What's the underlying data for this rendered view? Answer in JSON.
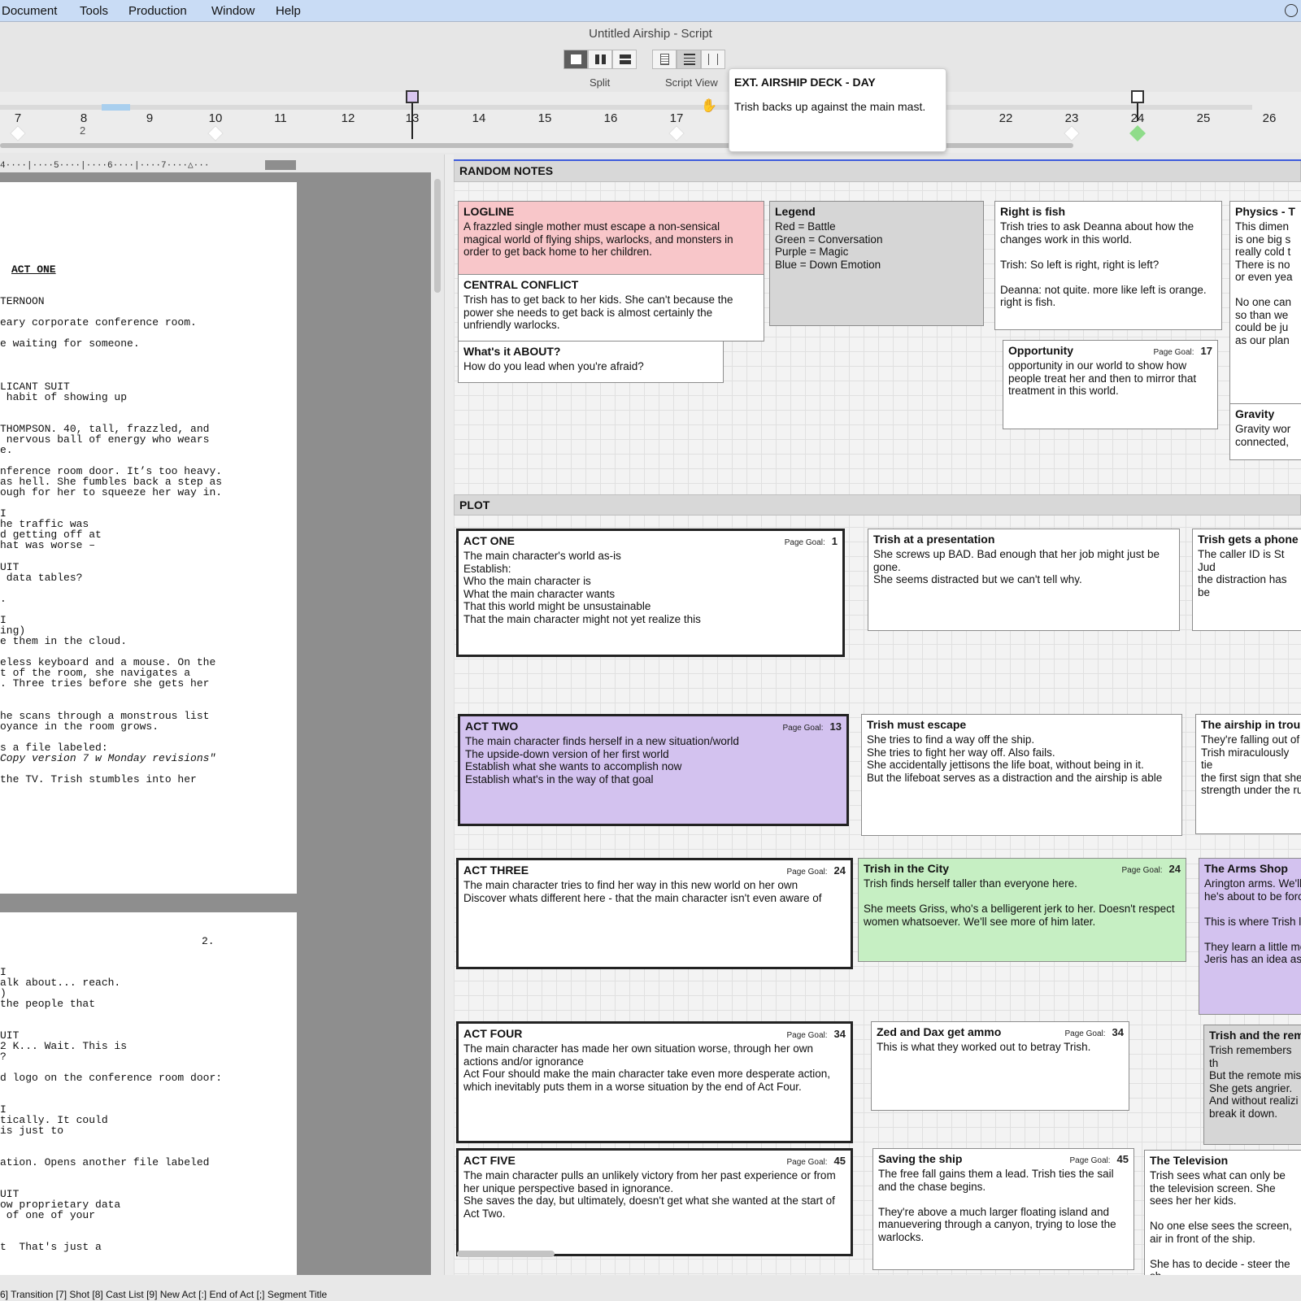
{
  "menu": {
    "items": [
      "Document",
      "Tools",
      "Production",
      "Window",
      "Help"
    ]
  },
  "window": {
    "title": "Untitled Airship - Script"
  },
  "toolbar": {
    "split_label": "Split",
    "script_view_label": "Script View"
  },
  "timeline": {
    "numbers": [
      "7",
      "8",
      "9",
      "10",
      "11",
      "12",
      "13",
      "14",
      "15",
      "16",
      "17",
      "22",
      "23",
      "24",
      "25",
      "26"
    ],
    "sub_label": "2"
  },
  "tooltip": {
    "heading": "EXT. AIRSHIP DECK - DAY",
    "body": "Trish backs up against the main mast."
  },
  "ruler": "4····|····5····|····6····|····7····△···",
  "script": {
    "page1": [
      "ACT ONE",
      "TERNOON",
      "eary corporate conference room.",
      "e waiting for someone.",
      "LICANT SUIT",
      " habit of showing up",
      "THOMPSON. 40, tall, frazzled, and",
      " nervous ball of energy who wears",
      "e.",
      "nference room door. It’s too heavy.",
      "as hell. She fumbles back a step as",
      "ough for her to squeeze her way in.",
      "I",
      "he traffic was",
      "d getting off at",
      "hat was worse –",
      "UIT",
      " data tables?",
      ".",
      "I",
      "ing)",
      "e them in the cloud.",
      "eless keyboard and a mouse. On the",
      "t of the room, she navigates a",
      ". Three tries before she gets her",
      "he scans through a monstrous list",
      "oyance in the room grows.",
      "s a file labeled:",
      "Copy version 7 w Monday revisions\"",
      "the TV. Trish stumbles into her"
    ],
    "page2_number": "2.",
    "page2": [
      "I",
      "alk about... reach.",
      ")",
      "the people that",
      "UIT",
      "2 K... Wait. This is",
      "?",
      "d logo on the conference room door:",
      "I",
      "tically. It could",
      "is just to",
      "ation. Opens another file labeled",
      "UIT",
      "ow proprietary data",
      " of one of your",
      "t  That's just a"
    ]
  },
  "board": {
    "random_notes_label": "RANDOM NOTES",
    "plot_label": "PLOT",
    "page_goal_label": "Page Goal:",
    "cards": {
      "logline": {
        "title": "LOGLINE",
        "body": "A frazzled single mother must escape a non-sensical magical world of flying ships, warlocks, and monsters in order to get back home to her children."
      },
      "central": {
        "title": "CENTRAL CONFLICT",
        "body": "Trish has to get back to her kids. She can't because the power she needs to get back is almost certainly the unfriendly warlocks."
      },
      "about": {
        "title": "What's it ABOUT?",
        "body": "How do you lead when you're afraid?"
      },
      "legend": {
        "title": "Legend",
        "body": "Red = Battle\nGreen = Conversation\nPurple = Magic\nBlue = Down Emotion"
      },
      "fish": {
        "title": "Right is fish",
        "body": "Trish tries to ask Deanna about how the changes work in this world.\n\nTrish: So left is right, right is left?\n\nDeanna: not quite. more like left is orange. right is fish."
      },
      "physics": {
        "title": "Physics - T",
        "body": "This dimen\nis one big s\nreally cold t\nThere is no\nor even yea\n\nNo one can\nso than we\ncould be ju\nas our plan"
      },
      "opportunity": {
        "title": "Opportunity",
        "goal": "17",
        "body": "opportunity in our world to show how people treat her and then to mirror that treatment in this world."
      },
      "gravity": {
        "title": "Gravity",
        "body": "Gravity wor\nconnected,"
      },
      "act1": {
        "title": "ACT ONE",
        "goal": "1",
        "body": "The main character's world as-is\nEstablish:\nWho the main character is\nWhat the main character wants\nThat this world might be unsustainable\nThat the main character might not yet realize this"
      },
      "presentation": {
        "title": "Trish at a presentation",
        "body": "She screws up BAD. Bad enough that her job might just be gone.\nShe seems distracted but we can't tell why."
      },
      "phone": {
        "title": "Trish gets a phone c",
        "body": "The caller ID is St Jud\nthe distraction has be"
      },
      "act2": {
        "title": "ACT TWO",
        "goal": "13",
        "body": "The main character finds herself in a new situation/world\nThe upside-down version of her first world\nEstablish what she wants to accomplish now\nEstablish what's in the way of that goal"
      },
      "escape": {
        "title": "Trish must escape",
        "body": "She tries to find a way off the ship.\nShe tries to fight her way off. Also fails.\nShe accidentally jettisons the life boat, without being in it.\nBut the lifeboat serves as a distraction and the airship is able"
      },
      "trouble": {
        "title": "The airship in troub",
        "body": "They're falling out of\nTrish miraculously tie\nthe first sign that she\nstrength under the ru"
      },
      "act3": {
        "title": "ACT THREE",
        "goal": "24",
        "body": "The main character tries to find her way in this new world on her own\nDiscover whats different here - that the main character isn't even aware of"
      },
      "city": {
        "title": "Trish in the City",
        "goal": "24",
        "body": "Trish finds herself taller than everyone here.\n\nShe meets Griss, who's a belligerent jerk to her. Doesn't respect women whatsoever. We'll see more of him later."
      },
      "arms": {
        "title": "The Arms Shop",
        "body": "Arington arms. We'll\nhe's about to be forc\n\nThis is where Trish l\n\nThey learn a little mo\nJeris has an idea as"
      },
      "act4": {
        "title": "ACT FOUR",
        "goal": "34",
        "body": "The main character has made her own situation worse, through her own actions and/or ignorance\nAct Four should make the main character take even more desperate action, which inevitably puts them in a worse situation by the end of Act Four."
      },
      "ammo": {
        "title": "Zed and Dax get ammo",
        "goal": "34",
        "body": "This is what they worked out to betray Trish."
      },
      "remote": {
        "title": "Trish and the rem",
        "body": "Trish remembers th\nBut the remote mis\nShe gets angrier.\nAnd without realizi\nbreak it down."
      },
      "act5": {
        "title": "ACT FIVE",
        "goal": "45",
        "body": "The main character pulls an unlikely victory from her past experience or from her unique perspective based in ignorance.\nShe saves the day, but ultimately, doesn't get what she wanted at the start of Act Two."
      },
      "saving": {
        "title": "Saving the ship",
        "goal": "45",
        "body": "The free fall gains them a lead. Trish ties the sail and the chase begins.\n\nThey're above a much larger floating island and manuevering through a canyon, trying to lose the warlocks."
      },
      "tv": {
        "title": "The Television",
        "body": "Trish sees what can only be the television screen. She sees her her kids.\n\nNo one else sees the screen, air in front of the ship.\n\nShe has to decide - steer the sh"
      }
    }
  },
  "statusbar": "6] Transition [7] Shot [8] Cast List [9] New Act [:] End of Act [;] Segment Title",
  "colors": {
    "menubar": "#c9dcf5",
    "red_card": "#f8c6c9",
    "purple_card": "#d3c2ef",
    "green_card": "#c6efc3",
    "gray_card": "#d6d6d6",
    "accent_line": "#3d5bdc"
  }
}
